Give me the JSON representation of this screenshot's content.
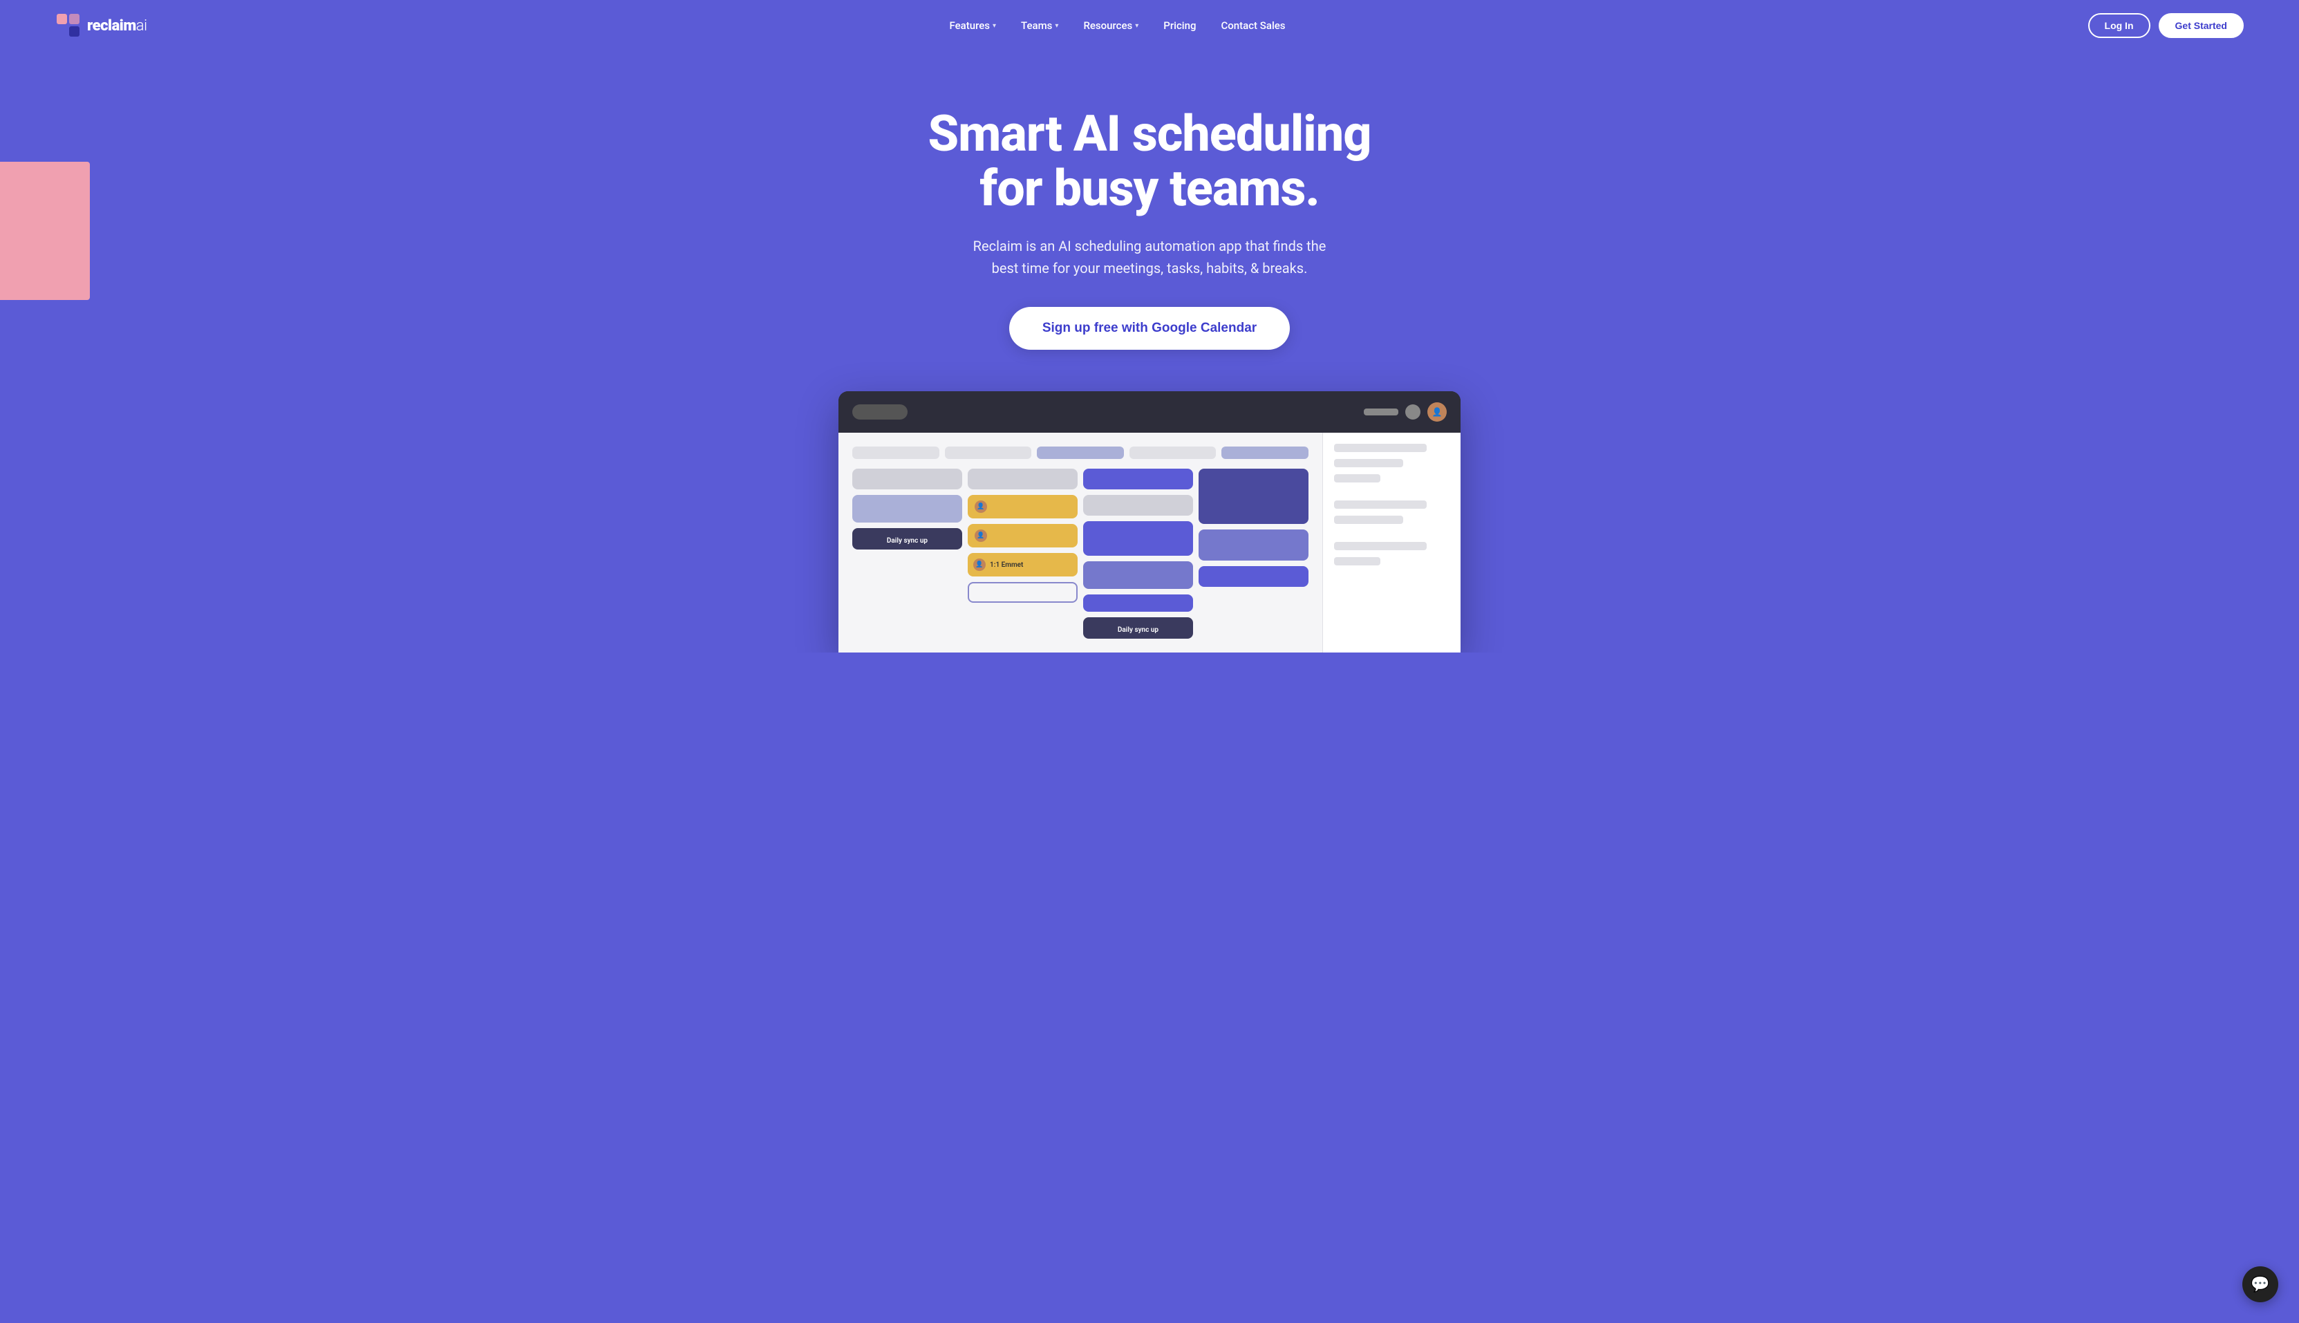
{
  "brand": {
    "name": "reclaim",
    "name_suffix": "ai",
    "logo_alt": "Reclaim AI Logo"
  },
  "nav": {
    "links": [
      {
        "id": "features",
        "label": "Features",
        "has_dropdown": true
      },
      {
        "id": "teams",
        "label": "Teams",
        "has_dropdown": true
      },
      {
        "id": "resources",
        "label": "Resources",
        "has_dropdown": true
      },
      {
        "id": "pricing",
        "label": "Pricing",
        "has_dropdown": false
      },
      {
        "id": "contact",
        "label": "Contact Sales",
        "has_dropdown": false
      }
    ],
    "login_label": "Log In",
    "get_started_label": "Get Started"
  },
  "hero": {
    "title": "Smart AI scheduling for busy teams.",
    "subtitle": "Reclaim is an AI scheduling automation app that finds the best time for your meetings, tasks, habits, & breaks.",
    "cta_label": "Sign up free with Google Calendar"
  },
  "calendar": {
    "event_labels": {
      "daily_sync_1": "Daily sync up",
      "daily_sync_2": "Daily sync up",
      "one_on_one": "1:1 Emmet"
    }
  },
  "chat": {
    "icon": "💬"
  }
}
